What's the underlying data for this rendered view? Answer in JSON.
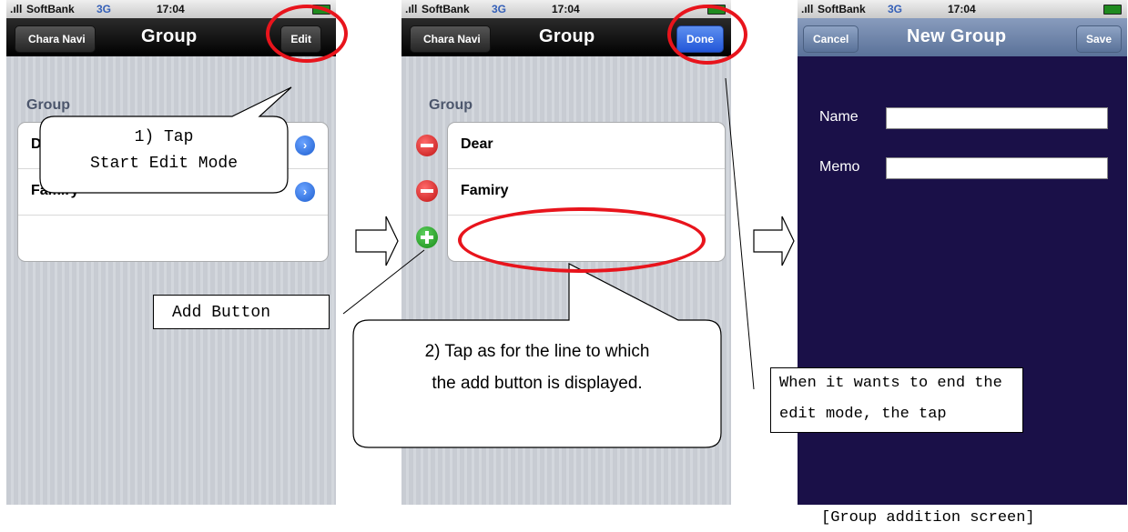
{
  "status_bar": {
    "carrier": "SoftBank",
    "network": "3G",
    "time": "17:04"
  },
  "screen1": {
    "back": "Chara Navi",
    "title": "Group",
    "edit": "Edit",
    "section": "Group",
    "rows": [
      "D",
      "Famiry"
    ]
  },
  "screen2": {
    "back": "Chara Navi",
    "title": "Group",
    "done": "Done",
    "section": "Group",
    "rows": [
      "Dear",
      "Famiry"
    ]
  },
  "screen3": {
    "cancel": "Cancel",
    "title": "New Group",
    "save": "Save",
    "name_label": "Name",
    "memo_label": "Memo"
  },
  "callouts": {
    "tap_line1": "1) Tap",
    "tap_line2": "Start Edit Mode",
    "add_button": "Add Button",
    "tap2_line1": "2) Tap as for the line to which",
    "tap2_line2": "the add button is displayed.",
    "end_line1": "When it wants to end the",
    "end_line2": "edit mode, the tap"
  },
  "caption": "[Group addition screen]",
  "colors": {
    "highlight": "#e8141c",
    "done_button": "#2256d8",
    "form_background": "#1a1048"
  }
}
